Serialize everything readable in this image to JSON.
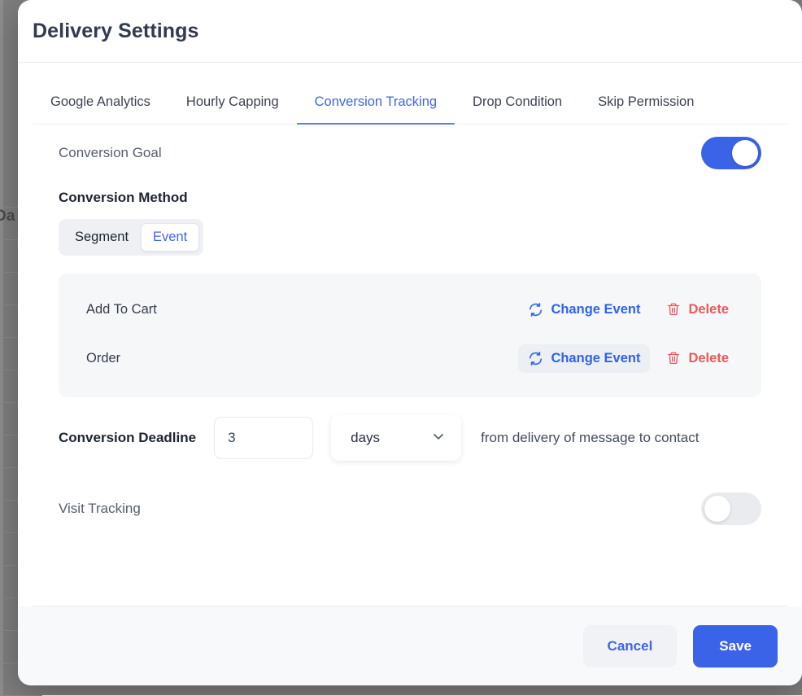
{
  "backdrop": {
    "partial_text": "Da"
  },
  "modal": {
    "title": "Delivery Settings",
    "tabs": [
      {
        "label": "Google Analytics",
        "active": false
      },
      {
        "label": "Hourly Capping",
        "active": false
      },
      {
        "label": "Conversion Tracking",
        "active": true
      },
      {
        "label": "Drop Condition",
        "active": false
      },
      {
        "label": "Skip Permission",
        "active": false
      }
    ],
    "conversion_goal": {
      "label": "Conversion Goal",
      "toggle_state": "on"
    },
    "conversion_method": {
      "label": "Conversion Method",
      "options": [
        {
          "label": "Segment",
          "selected": false
        },
        {
          "label": "Event",
          "selected": true
        }
      ]
    },
    "events": [
      {
        "name": "Add To Cart",
        "change_label": "Change Event",
        "delete_label": "Delete",
        "hovered": false
      },
      {
        "name": "Order",
        "change_label": "Change Event",
        "delete_label": "Delete",
        "hovered": true
      }
    ],
    "deadline": {
      "label": "Conversion Deadline",
      "value": "3",
      "unit": "days",
      "suffix": "from delivery of message to contact"
    },
    "visit_tracking": {
      "label": "Visit Tracking",
      "toggle_state": "off"
    },
    "footer": {
      "cancel_label": "Cancel",
      "save_label": "Save"
    }
  },
  "colors": {
    "accent_blue": "#3b63e8",
    "link_blue": "#3f66e4",
    "danger_red": "#ea5a5a",
    "title_navy": "#323a4d",
    "panel_gray": "#f6f7f9",
    "footer_gray": "#f8f9fb"
  }
}
